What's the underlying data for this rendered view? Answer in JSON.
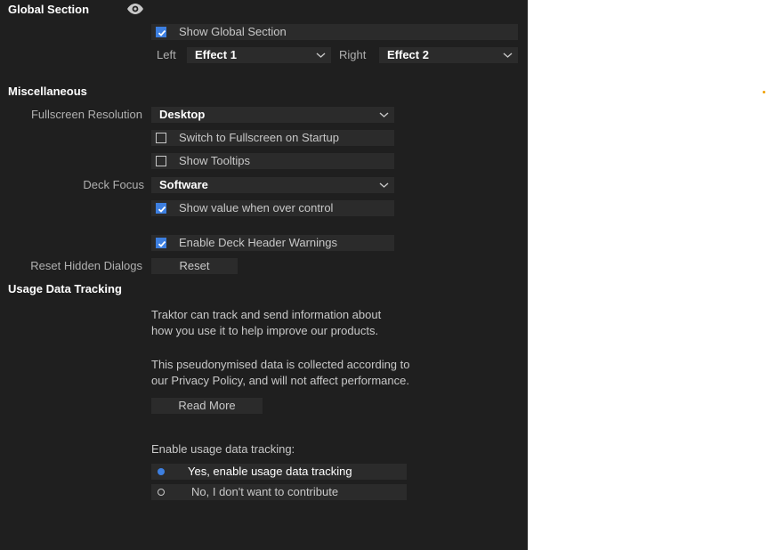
{
  "global_section": {
    "heading": "Global Section",
    "show_global_section": {
      "label": "Show Global Section",
      "checked": true
    },
    "left_label": "Left",
    "left_value": "Effect 1",
    "right_label": "Right",
    "right_value": "Effect 2"
  },
  "misc": {
    "heading": "Miscellaneous",
    "fullscreen_label": "Fullscreen Resolution",
    "fullscreen_value": "Desktop",
    "switch_fullscreen": {
      "label": "Switch to Fullscreen on Startup",
      "checked": false
    },
    "show_tooltips": {
      "label": "Show Tooltips",
      "checked": false
    },
    "deck_focus_label": "Deck Focus",
    "deck_focus_value": "Software",
    "show_value": {
      "label": "Show value when over control",
      "checked": true
    },
    "deck_header_warnings": {
      "label": "Enable Deck Header Warnings",
      "checked": true
    },
    "reset_hidden_label": "Reset Hidden Dialogs",
    "reset_button": "Reset"
  },
  "usage": {
    "heading": "Usage Data Tracking",
    "para1_line1": "Traktor can track and send information about",
    "para1_line2": "how you use it to help improve our products.",
    "para2_line1": "This pseudonymised data is collected according to",
    "para2_line2": "our Privacy Policy, and will not affect performance.",
    "read_more": "Read More",
    "enable_label": "Enable usage data tracking:",
    "option_yes": "Yes, enable usage data tracking",
    "option_no": "No, I don't want to contribute",
    "selected": "yes"
  },
  "colors": {
    "accent": "#3d7fe0",
    "panel_bg": "#1f1f1f",
    "field_bg": "#2b2b2b",
    "dot_orange": "#f0a000"
  }
}
